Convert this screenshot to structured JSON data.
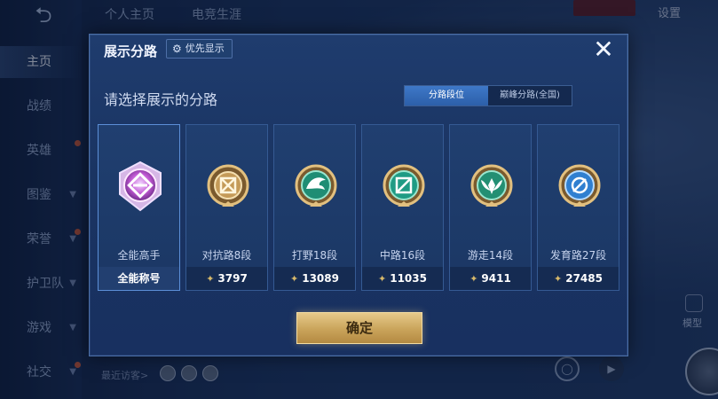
{
  "background": {
    "top_tabs": [
      "个人主页",
      "电竞生涯"
    ],
    "settings_label": "设置",
    "sidebar": [
      {
        "label": "主页",
        "active": true,
        "chevron": false
      },
      {
        "label": "战绩",
        "active": false,
        "chevron": false
      },
      {
        "label": "英雄",
        "active": false,
        "chevron": false
      },
      {
        "label": "图鉴",
        "active": false,
        "chevron": true
      },
      {
        "label": "荣誉",
        "active": false,
        "chevron": true
      },
      {
        "label": "护卫队",
        "active": false,
        "chevron": true
      },
      {
        "label": "游戏",
        "active": false,
        "chevron": true
      },
      {
        "label": "社交",
        "active": false,
        "chevron": true
      }
    ],
    "recent_visitors_label": "最近访客>",
    "model_label": "模型"
  },
  "modal": {
    "title": "展示分路",
    "priority_button": "优先显示",
    "subtitle": "请选择展示的分路",
    "toggle": {
      "selected": "分路段位",
      "other": "巅峰分路(全国)"
    },
    "cards": [
      {
        "role": "全能高手",
        "footer": "全能称号",
        "points": null,
        "emblem_color": "#c45bd6",
        "selected": true
      },
      {
        "role": "对抗路8段",
        "footer": "3797",
        "points": 3797,
        "emblem_color": "#c49a58",
        "selected": false
      },
      {
        "role": "打野18段",
        "footer": "13089",
        "points": 13089,
        "emblem_color": "#2fae8e",
        "selected": false
      },
      {
        "role": "中路16段",
        "footer": "11035",
        "points": 11035,
        "emblem_color": "#2fb59a",
        "selected": false
      },
      {
        "role": "游走14段",
        "footer": "9411",
        "points": 9411,
        "emblem_color": "#3aa98a",
        "selected": false
      },
      {
        "role": "发育路27段",
        "footer": "27485",
        "points": 27485,
        "emblem_color": "#4a9ee6",
        "selected": false
      }
    ],
    "confirm_button": "确定",
    "close_icon": "close-icon"
  },
  "colors": {
    "accent_blue": "#2c5fa9",
    "gold": "#c9a35a",
    "panel": "#1a3462"
  }
}
